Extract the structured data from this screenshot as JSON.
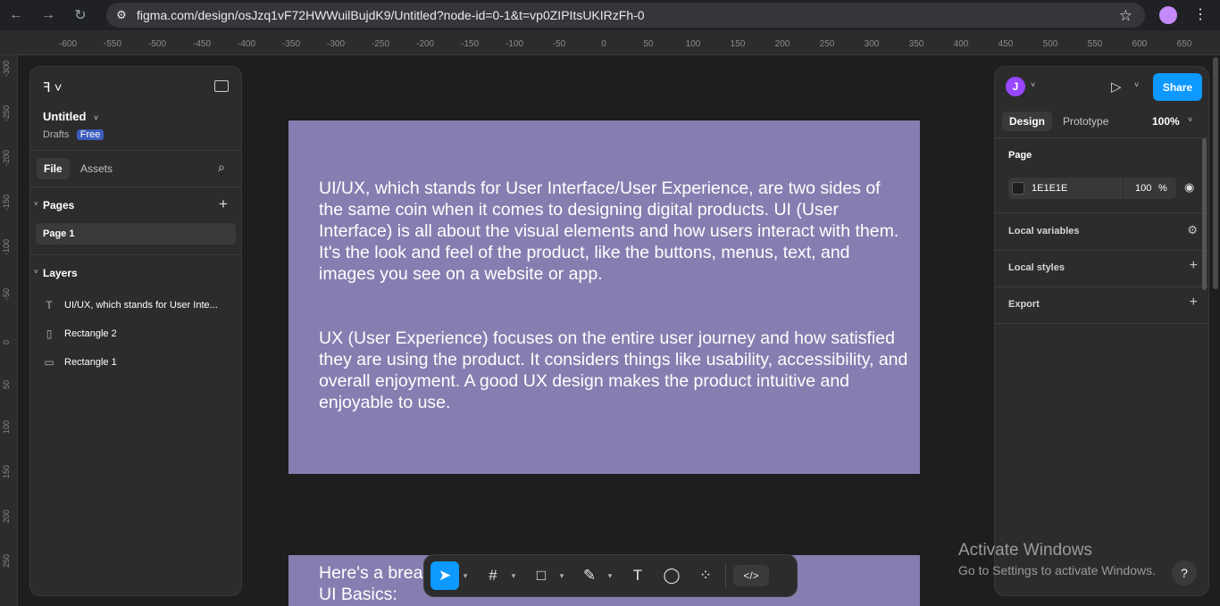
{
  "browser": {
    "url": "figma.com/design/osJzq1vF72HWWuilBujdK9/Untitled?node-id=0-1&t=vp0ZIPItsUKIRzFh-0",
    "back_icon": "arrow-left-icon",
    "forward_icon": "arrow-right-icon",
    "reload_icon": "reload-icon"
  },
  "rulers": {
    "top": [
      "-600",
      "-550",
      "-500",
      "-450",
      "-400",
      "-350",
      "-300",
      "-250",
      "-200",
      "-150",
      "-100",
      "-50",
      "0",
      "50",
      "100",
      "150",
      "200",
      "250",
      "300",
      "350",
      "400",
      "450",
      "500",
      "550",
      "600",
      "650"
    ],
    "left": [
      "-300",
      "-250",
      "-200",
      "-150",
      "-100",
      "-50",
      "0",
      "50",
      "100",
      "150",
      "200",
      "250"
    ]
  },
  "left_panel": {
    "file_name": "Untitled",
    "location": "Drafts",
    "plan_badge": "Free",
    "tabs": {
      "file": "File",
      "assets": "Assets"
    },
    "pages_header": "Pages",
    "pages": [
      "Page 1"
    ],
    "layers_header": "Layers",
    "layers": [
      {
        "name": "UI/UX, which stands for User Inte...",
        "icon": "text-icon"
      },
      {
        "name": "Rectangle 2",
        "icon": "rectangle-vertical-icon"
      },
      {
        "name": "Rectangle 1",
        "icon": "rectangle-icon"
      }
    ]
  },
  "canvas": {
    "frame1_text": "UI/UX, which stands for User Interface/User Experience, are two sides of the same coin when it comes to designing digital products. UI (User Interface) is all about the visual elements and how users interact with them. It's the look and feel of the product, like the buttons, menus, text, and images you see on a website or app.",
    "frame1_text2": "UX (User Experience) focuses on the entire user journey and how satisfied they are using the product. It considers things like usability, accessibility, and overall enjoyment. A good UX design makes the product intuitive and enjoyable to use.",
    "frame2_line1": "Here's a brea",
    "frame2_line2": "UI Basics:",
    "frame_color": "#877db0"
  },
  "right_panel": {
    "avatar_initial": "J",
    "share_label": "Share",
    "tabs": {
      "design": "Design",
      "prototype": "Prototype"
    },
    "zoom": "100%",
    "page_section": "Page",
    "page_color": "1E1E1E",
    "page_opacity": "100",
    "percent": "%",
    "local_variables": "Local variables",
    "local_styles": "Local styles",
    "export": "Export"
  },
  "watermark": {
    "title": "Activate Windows",
    "subtitle": "Go to Settings to activate Windows."
  },
  "help_label": "?",
  "accent_color": "#0d99ff"
}
